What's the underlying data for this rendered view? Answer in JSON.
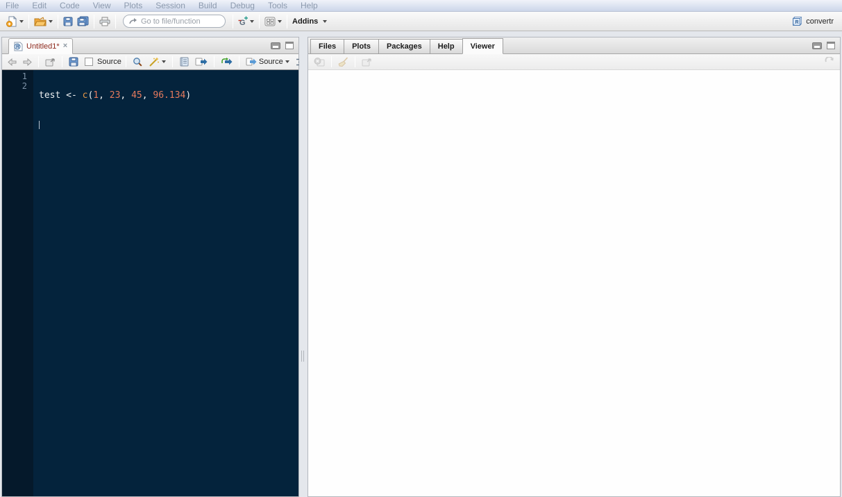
{
  "window": {
    "project_name": "convertr"
  },
  "menu_bar": {
    "items": [
      "File",
      "Edit",
      "Code",
      "View",
      "Plots",
      "Session",
      "Build",
      "Debug",
      "Tools",
      "Help"
    ]
  },
  "main_toolbar": {
    "go_to_file_placeholder": "Go to file/function",
    "addins_label": "Addins",
    "icons": [
      "new-file-icon",
      "open-file-icon",
      "save-icon",
      "save-all-icon",
      "print-icon",
      "goto-arrow-icon",
      "version-control-icon",
      "workspace-panes-icon",
      "project-cube-icon"
    ]
  },
  "source_pane": {
    "tab_title": "Untitled1*",
    "tab_close_symbol": "×",
    "toolbar": {
      "source_on_save_label": "Source",
      "source_button_label": "Source",
      "icons": [
        "back-icon",
        "forward-icon",
        "popout-icon",
        "save-icon",
        "source-on-save-checkbox",
        "find-icon",
        "code-tools-icon",
        "compile-notebook-icon",
        "run-icon",
        "rerun-icon",
        "source-button",
        "outline-icon"
      ]
    },
    "editor": {
      "line1": {
        "number": "1",
        "var": "test ",
        "assign": "<- ",
        "func": "c",
        "open": "(",
        "n1": "1",
        "sep1": ", ",
        "n2": "23",
        "sep2": ", ",
        "n3": "45",
        "sep3": ", ",
        "n4": "96.134",
        "close": ")"
      },
      "line2": {
        "number": "2"
      }
    }
  },
  "right_pane": {
    "tabs": [
      "Files",
      "Plots",
      "Packages",
      "Help",
      "Viewer"
    ],
    "active_tab": "Viewer",
    "toolbar_icons": [
      "stop-icon",
      "broom-icon",
      "popout-icon",
      "refresh-icon"
    ]
  },
  "colors": {
    "editor_background": "#04233c",
    "gutter_background": "#05192b",
    "line_number": "#7e93a8",
    "code_plain": "#eceff1",
    "code_function": "#e39545",
    "code_number": "#e57a5d",
    "unsaved_tab_title": "#8e2a1e",
    "menu_text": "#8b99ad",
    "menu_gradient_top": "#f0f3fa",
    "menu_gradient_bottom": "#ccd6ea"
  }
}
